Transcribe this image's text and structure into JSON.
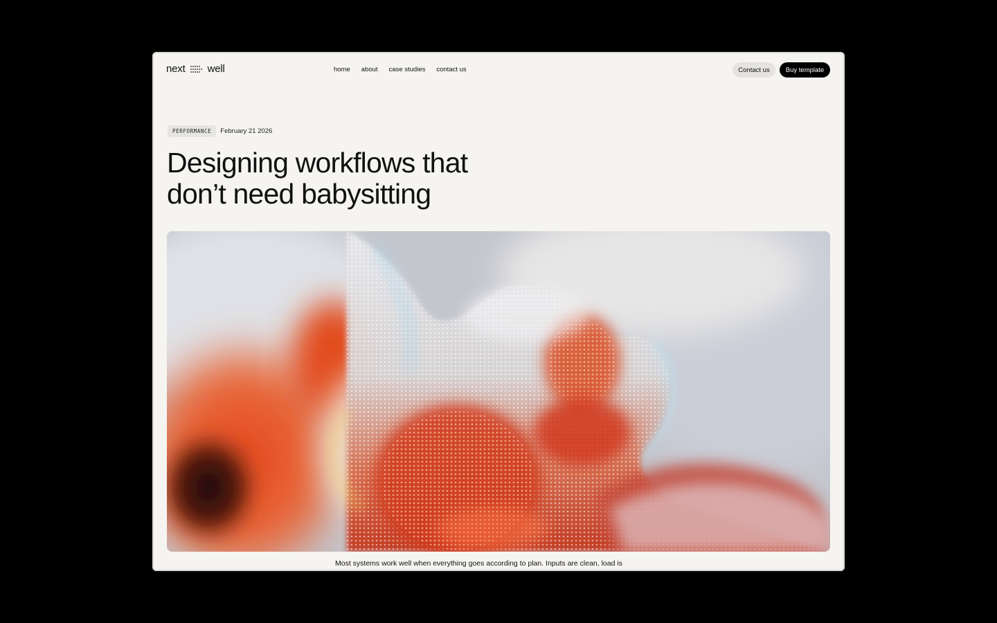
{
  "nav": {
    "logo_left": "next",
    "logo_right": "well",
    "links": [
      "home",
      "about",
      "case studies",
      "contact us"
    ],
    "contact_label": "Contact us",
    "buy_label": "Buy template"
  },
  "article": {
    "tag": "PERFORMANCE",
    "date": "February 21 2026",
    "title_line1": "Designing workflows that",
    "title_line2": "don’t need babysitting",
    "excerpt": "Most systems work well when everything goes according to plan. Inputs are clean, load is"
  },
  "hero": {
    "icon": "abstract-mesh-image",
    "colors": [
      "#c23a1c",
      "#e8542a",
      "#f1b48e",
      "#d9dbe2",
      "#b9bdc9"
    ]
  }
}
